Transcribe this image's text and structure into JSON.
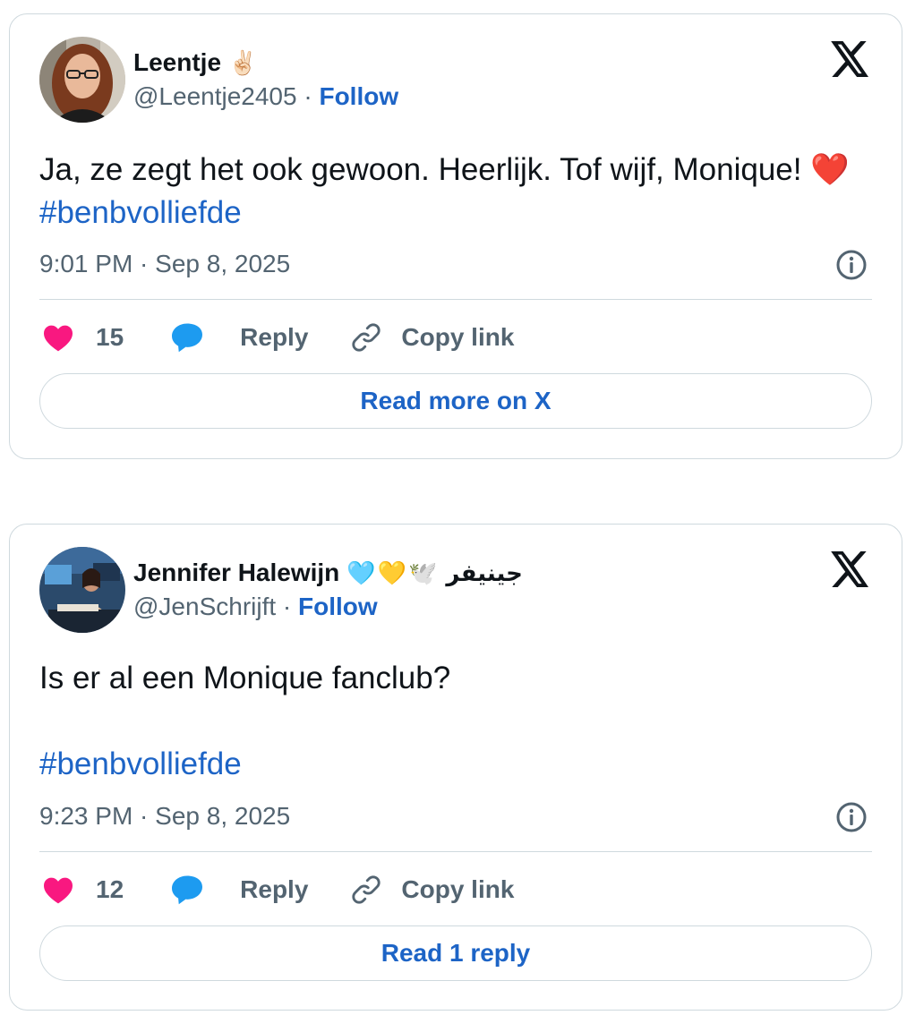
{
  "tweets": [
    {
      "display_name": "Leentje",
      "name_emoji": "✌🏻",
      "handle": "@Leentje2405",
      "separator": "·",
      "follow_label": "Follow",
      "text_part1": "Ja, ze zegt het ook gewoon. Heerlijk. Tof wijf, Monique!",
      "text_emoji": "❤️",
      "hashtag": "#benbvolliefde",
      "timestamp": "9:01 PM · Sep 8, 2025",
      "like_count": "15",
      "reply_label": "Reply",
      "copy_label": "Copy link",
      "read_button_label": "Read more on X",
      "logo_icon": "x-logo-icon"
    },
    {
      "display_name": "Jennifer Halewijn",
      "name_emoji": "🩵💛🕊️",
      "name_arabic": "جينيفر",
      "handle": "@JenSchrijft",
      "separator": "·",
      "follow_label": "Follow",
      "text_part1": "Is er al een Monique fanclub?",
      "hashtag": "#benbvolliefde",
      "timestamp": "9:23 PM · Sep 8, 2025",
      "like_count": "12",
      "reply_label": "Reply",
      "copy_label": "Copy link",
      "read_button_label": "Read 1 reply",
      "logo_icon": "x-logo-icon"
    }
  ],
  "colors": {
    "link_blue": "#1d64c6",
    "like_pink": "#f91880",
    "reply_blue": "#1d9bf0",
    "muted_gray": "#536471",
    "border": "#cfd9de"
  }
}
